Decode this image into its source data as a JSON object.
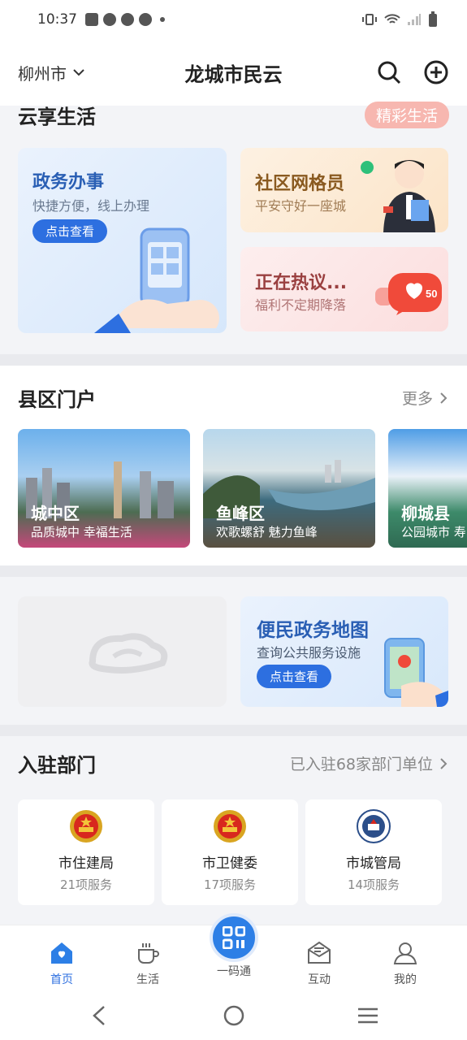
{
  "status": {
    "time": "10:37"
  },
  "header": {
    "city": "柳州市",
    "title": "龙城市民云"
  },
  "life": {
    "title": "云享生活",
    "badge": "精彩生活",
    "cards": [
      {
        "title": "政务办事",
        "subtitle": "快捷方便，线上办理",
        "button": "点击查看"
      },
      {
        "title": "社区网格员",
        "subtitle": "平安守好一座城"
      },
      {
        "title": "正在热议...",
        "subtitle": "福利不定期降落"
      }
    ]
  },
  "districts": {
    "title": "县区门户",
    "more": "更多",
    "items": [
      {
        "name": "城中区",
        "desc": "品质城中 幸福生活"
      },
      {
        "name": "鱼峰区",
        "desc": "欢歌螺舒 魅力鱼峰"
      },
      {
        "name": "柳城县",
        "desc": "公园城市 寿"
      }
    ]
  },
  "map_card": {
    "title": "便民政务地图",
    "subtitle": "查询公共服务设施",
    "button": "点击查看"
  },
  "departments": {
    "title": "入驻部门",
    "summary": "已入驻68家部门单位",
    "items": [
      {
        "name": "市住建局",
        "count": "21项服务"
      },
      {
        "name": "市卫健委",
        "count": "17项服务"
      },
      {
        "name": "市城管局",
        "count": "14项服务"
      }
    ]
  },
  "tabbar": {
    "items": [
      {
        "label": "首页"
      },
      {
        "label": "生活"
      },
      {
        "label": "一码通"
      },
      {
        "label": "互动"
      },
      {
        "label": "我的"
      }
    ]
  },
  "colors": {
    "accent": "#2d6fe0",
    "badge": "#f7b7b0"
  }
}
